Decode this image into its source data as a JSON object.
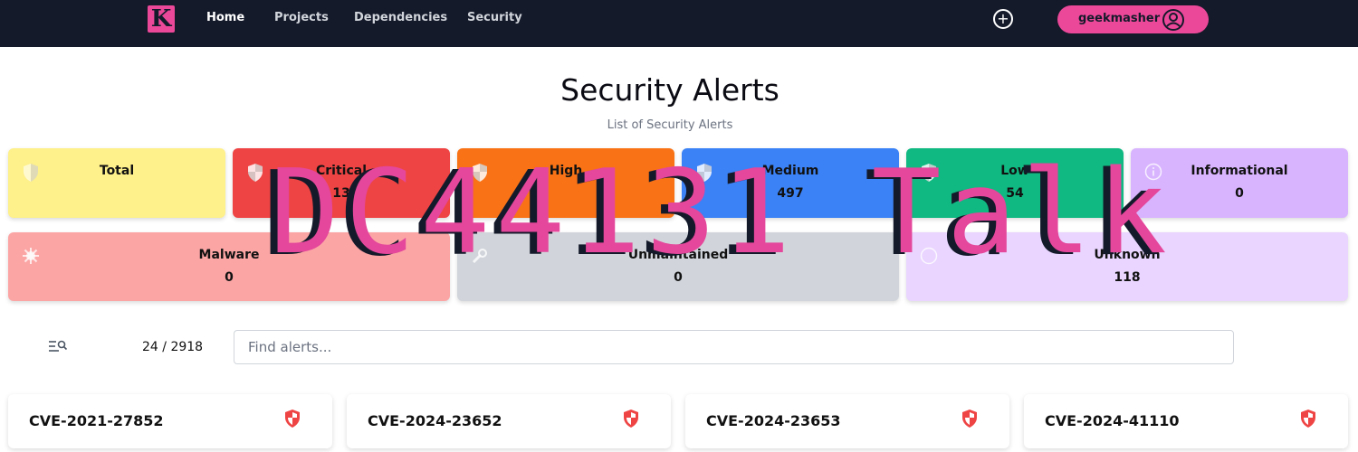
{
  "nav": {
    "logo_letter": "K",
    "links": [
      "Home",
      "Projects",
      "Dependencies",
      "Security"
    ],
    "active": "Home",
    "add_icon": "plus-circle-icon",
    "username": "geekmasher",
    "user_icon": "user-circle-icon"
  },
  "header": {
    "title": "Security Alerts",
    "subtitle": "List of Security Alerts"
  },
  "summary_cards": [
    {
      "label": "Total",
      "value": "",
      "color": "#fef08a",
      "icon": "shield-icon"
    },
    {
      "label": "Critical",
      "value": "13",
      "color": "#ef4444",
      "icon": "shield-icon"
    },
    {
      "label": "High",
      "value": "",
      "color": "#f97316",
      "icon": "shield-icon"
    },
    {
      "label": "Medium",
      "value": "497",
      "color": "#3b82f6",
      "icon": "shield-icon"
    },
    {
      "label": "Low",
      "value": "54",
      "color": "#10b981",
      "icon": "shield-icon"
    },
    {
      "label": "Informational",
      "value": "0",
      "color": "#d8b4fe",
      "icon": "info-icon"
    },
    {
      "label": "Malware",
      "value": "0",
      "color": "#fca5a5",
      "icon": "bug-icon"
    },
    {
      "label": "Unmaintained",
      "value": "0",
      "color": "#d1d5db",
      "icon": "wrench-icon"
    },
    {
      "label": "Unknown",
      "value": "118",
      "color": "#e9d5ff",
      "icon": "question-icon"
    }
  ],
  "filter": {
    "icon": "filter-search-icon",
    "shown": "24",
    "separator": "/",
    "total": "2918",
    "placeholder": "Find alerts..."
  },
  "alerts": [
    {
      "id": "CVE-2021-27852",
      "severity_icon": "shield-icon",
      "color": "#ef4444"
    },
    {
      "id": "CVE-2024-23652",
      "severity_icon": "shield-icon",
      "color": "#ef4444"
    },
    {
      "id": "CVE-2024-23653",
      "severity_icon": "shield-icon",
      "color": "#ef4444"
    },
    {
      "id": "CVE-2024-41110",
      "severity_icon": "shield-icon",
      "color": "#ef4444"
    }
  ],
  "overlay": {
    "text": "DC44131 Talk"
  }
}
